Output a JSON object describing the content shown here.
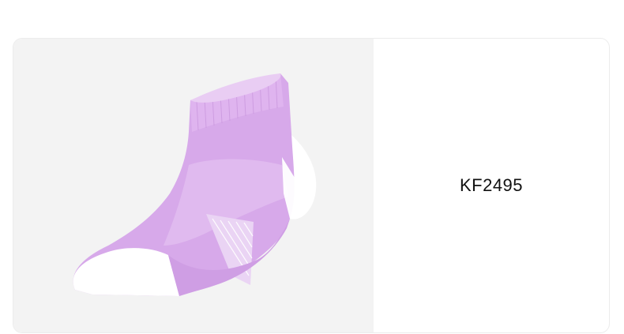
{
  "product_card": {
    "image": {
      "icon": "sock-product-photo",
      "colors": {
        "background": "#f3f3f3",
        "sock_main": "#d7a9ea",
        "sock_light": "#e9cdf3",
        "sock_rib_line": "#c794dc",
        "sock_white": "#ffffff"
      }
    },
    "code": "KF2495"
  }
}
